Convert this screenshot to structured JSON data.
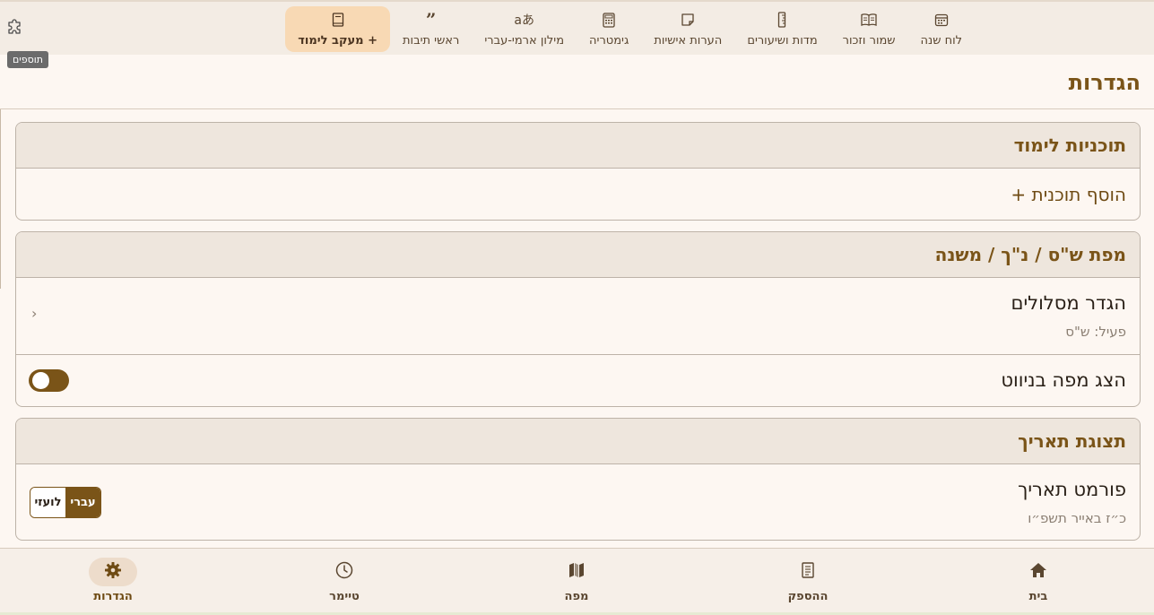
{
  "toolbar": {
    "items": [
      {
        "label": "לוח שנה",
        "icon": "calendar-icon"
      },
      {
        "label": "שמור וזכור",
        "icon": "open-book-icon"
      },
      {
        "label": "מדות ושיעורים",
        "icon": "ruler-icon"
      },
      {
        "label": "הערות אישיות",
        "icon": "sticky-note-icon"
      },
      {
        "label": "גימטריה",
        "icon": "calculator-icon"
      },
      {
        "label": "מילון ארמי-עברי",
        "icon": "translate-icon"
      },
      {
        "label": "ראשי תיבות",
        "icon": "quote-icon"
      },
      {
        "label": "מעקב לימוד +",
        "icon": "book-icon"
      }
    ],
    "addons_tooltip": "תוספים"
  },
  "page": {
    "title": "הגדרות"
  },
  "study_plans": {
    "header": "תוכניות לימוד",
    "add_label": "+ הוסף תוכנית"
  },
  "map_section": {
    "header": "מפת ש\"ס / נ\"ך / משנה",
    "routes_title": "הגדר מסלולים",
    "routes_sub": "פעיל: ש\"ס",
    "nav_map_title": "הצג מפה בניווט"
  },
  "date_section": {
    "header": "תצוגת תאריך",
    "format_title": "פורמט תאריך",
    "format_sub": "כ״ז באייר תשפ״ו",
    "opt_hebrew": "עברי",
    "opt_civil": "לועזי"
  },
  "bottom_nav": {
    "home": "בית",
    "hespek": "ההספק",
    "map": "מפה",
    "timer": "טיימר",
    "settings": "הגדרות"
  },
  "colors": {
    "accent": "#7a5418",
    "active_tab_bg": "#f8d9b4"
  }
}
